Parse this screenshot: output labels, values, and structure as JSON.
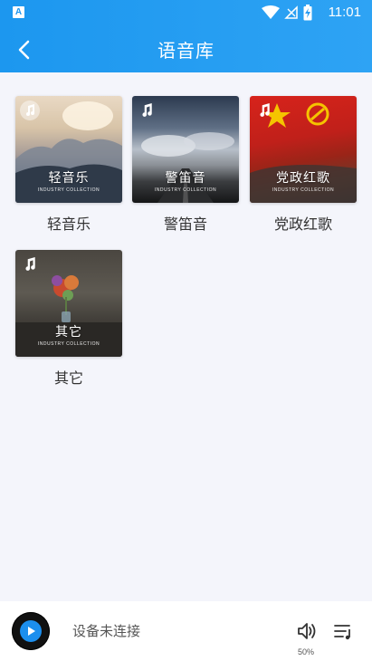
{
  "status_bar": {
    "app_badge": "A",
    "time": "11:01",
    "icons": [
      "wifi-icon",
      "no-signal-icon",
      "battery-charging-icon"
    ]
  },
  "header": {
    "title": "语音库",
    "back_icon": "chevron-left-icon"
  },
  "library": {
    "items": [
      {
        "label": "轻音乐",
        "overlay_title": "轻音乐",
        "overlay_sub": "INDUSTRY COLLECTION",
        "badge_icon": "music-note-icon"
      },
      {
        "label": "警笛音",
        "overlay_title": "警笛音",
        "overlay_sub": "INDUSTRY COLLECTION",
        "badge_icon": "music-note-icon"
      },
      {
        "label": "党政红歌",
        "overlay_title": "党政红歌",
        "overlay_sub": "INDUSTRY COLLECTION",
        "badge_icon": "music-note-icon"
      },
      {
        "label": "其它",
        "overlay_title": "其它",
        "overlay_sub": "INDUSTRY COLLECTION",
        "badge_icon": "music-note-icon"
      }
    ]
  },
  "player": {
    "status": "设备未连接",
    "volume_label": "50%",
    "volume_value": 0.5,
    "play_icon": "play-icon",
    "volume_icon": "volume-icon",
    "playlist_icon": "playlist-icon"
  },
  "colors": {
    "accent": "#1c97ef",
    "background": "#f4f5fb"
  }
}
